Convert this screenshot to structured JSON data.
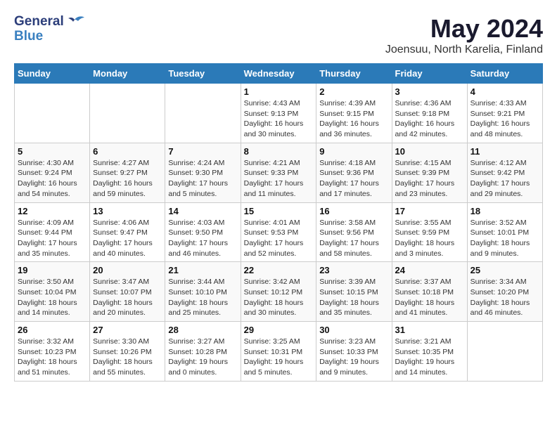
{
  "logo": {
    "line1": "General",
    "line2": "Blue"
  },
  "title": {
    "month": "May 2024",
    "location": "Joensuu, North Karelia, Finland"
  },
  "weekdays": [
    "Sunday",
    "Monday",
    "Tuesday",
    "Wednesday",
    "Thursday",
    "Friday",
    "Saturday"
  ],
  "weeks": [
    [
      {
        "day": "",
        "info": ""
      },
      {
        "day": "",
        "info": ""
      },
      {
        "day": "",
        "info": ""
      },
      {
        "day": "1",
        "info": "Sunrise: 4:43 AM\nSunset: 9:13 PM\nDaylight: 16 hours\nand 30 minutes."
      },
      {
        "day": "2",
        "info": "Sunrise: 4:39 AM\nSunset: 9:15 PM\nDaylight: 16 hours\nand 36 minutes."
      },
      {
        "day": "3",
        "info": "Sunrise: 4:36 AM\nSunset: 9:18 PM\nDaylight: 16 hours\nand 42 minutes."
      },
      {
        "day": "4",
        "info": "Sunrise: 4:33 AM\nSunset: 9:21 PM\nDaylight: 16 hours\nand 48 minutes."
      }
    ],
    [
      {
        "day": "5",
        "info": "Sunrise: 4:30 AM\nSunset: 9:24 PM\nDaylight: 16 hours\nand 54 minutes."
      },
      {
        "day": "6",
        "info": "Sunrise: 4:27 AM\nSunset: 9:27 PM\nDaylight: 16 hours\nand 59 minutes."
      },
      {
        "day": "7",
        "info": "Sunrise: 4:24 AM\nSunset: 9:30 PM\nDaylight: 17 hours\nand 5 minutes."
      },
      {
        "day": "8",
        "info": "Sunrise: 4:21 AM\nSunset: 9:33 PM\nDaylight: 17 hours\nand 11 minutes."
      },
      {
        "day": "9",
        "info": "Sunrise: 4:18 AM\nSunset: 9:36 PM\nDaylight: 17 hours\nand 17 minutes."
      },
      {
        "day": "10",
        "info": "Sunrise: 4:15 AM\nSunset: 9:39 PM\nDaylight: 17 hours\nand 23 minutes."
      },
      {
        "day": "11",
        "info": "Sunrise: 4:12 AM\nSunset: 9:42 PM\nDaylight: 17 hours\nand 29 minutes."
      }
    ],
    [
      {
        "day": "12",
        "info": "Sunrise: 4:09 AM\nSunset: 9:44 PM\nDaylight: 17 hours\nand 35 minutes."
      },
      {
        "day": "13",
        "info": "Sunrise: 4:06 AM\nSunset: 9:47 PM\nDaylight: 17 hours\nand 40 minutes."
      },
      {
        "day": "14",
        "info": "Sunrise: 4:03 AM\nSunset: 9:50 PM\nDaylight: 17 hours\nand 46 minutes."
      },
      {
        "day": "15",
        "info": "Sunrise: 4:01 AM\nSunset: 9:53 PM\nDaylight: 17 hours\nand 52 minutes."
      },
      {
        "day": "16",
        "info": "Sunrise: 3:58 AM\nSunset: 9:56 PM\nDaylight: 17 hours\nand 58 minutes."
      },
      {
        "day": "17",
        "info": "Sunrise: 3:55 AM\nSunset: 9:59 PM\nDaylight: 18 hours\nand 3 minutes."
      },
      {
        "day": "18",
        "info": "Sunrise: 3:52 AM\nSunset: 10:01 PM\nDaylight: 18 hours\nand 9 minutes."
      }
    ],
    [
      {
        "day": "19",
        "info": "Sunrise: 3:50 AM\nSunset: 10:04 PM\nDaylight: 18 hours\nand 14 minutes."
      },
      {
        "day": "20",
        "info": "Sunrise: 3:47 AM\nSunset: 10:07 PM\nDaylight: 18 hours\nand 20 minutes."
      },
      {
        "day": "21",
        "info": "Sunrise: 3:44 AM\nSunset: 10:10 PM\nDaylight: 18 hours\nand 25 minutes."
      },
      {
        "day": "22",
        "info": "Sunrise: 3:42 AM\nSunset: 10:12 PM\nDaylight: 18 hours\nand 30 minutes."
      },
      {
        "day": "23",
        "info": "Sunrise: 3:39 AM\nSunset: 10:15 PM\nDaylight: 18 hours\nand 35 minutes."
      },
      {
        "day": "24",
        "info": "Sunrise: 3:37 AM\nSunset: 10:18 PM\nDaylight: 18 hours\nand 41 minutes."
      },
      {
        "day": "25",
        "info": "Sunrise: 3:34 AM\nSunset: 10:20 PM\nDaylight: 18 hours\nand 46 minutes."
      }
    ],
    [
      {
        "day": "26",
        "info": "Sunrise: 3:32 AM\nSunset: 10:23 PM\nDaylight: 18 hours\nand 51 minutes."
      },
      {
        "day": "27",
        "info": "Sunrise: 3:30 AM\nSunset: 10:26 PM\nDaylight: 18 hours\nand 55 minutes."
      },
      {
        "day": "28",
        "info": "Sunrise: 3:27 AM\nSunset: 10:28 PM\nDaylight: 19 hours\nand 0 minutes."
      },
      {
        "day": "29",
        "info": "Sunrise: 3:25 AM\nSunset: 10:31 PM\nDaylight: 19 hours\nand 5 minutes."
      },
      {
        "day": "30",
        "info": "Sunrise: 3:23 AM\nSunset: 10:33 PM\nDaylight: 19 hours\nand 9 minutes."
      },
      {
        "day": "31",
        "info": "Sunrise: 3:21 AM\nSunset: 10:35 PM\nDaylight: 19 hours\nand 14 minutes."
      },
      {
        "day": "",
        "info": ""
      }
    ]
  ]
}
